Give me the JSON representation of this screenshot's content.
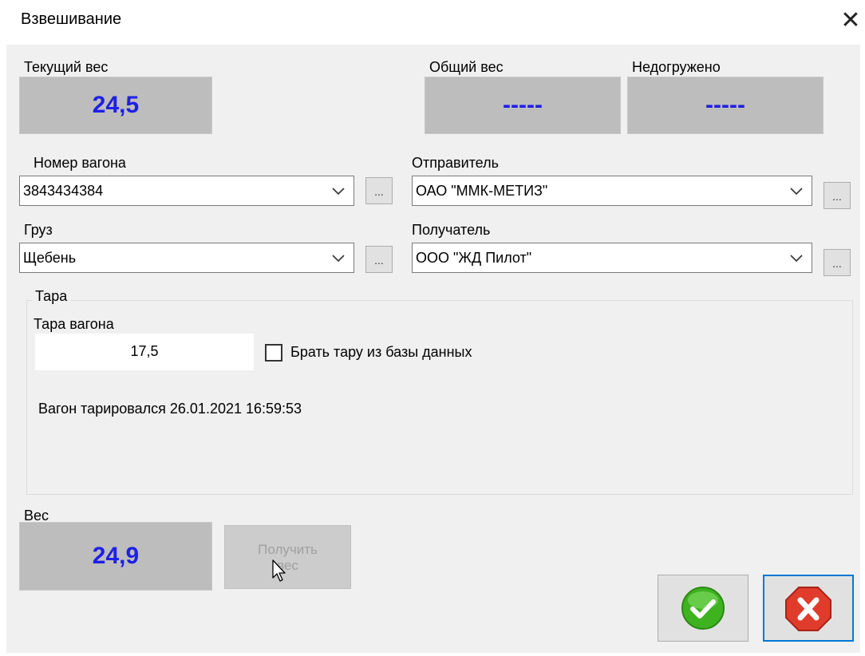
{
  "window": {
    "title": "Взвешивание"
  },
  "current_weight": {
    "label": "Текущий вес",
    "value": "24,5"
  },
  "total_weight": {
    "label": "Общий вес",
    "value": "-----"
  },
  "underloaded": {
    "label": "Недогружено",
    "value": "-----"
  },
  "wagon_number": {
    "label": "Номер вагона",
    "value": "3843434384",
    "browse_label": "..."
  },
  "sender": {
    "label": "Отправитель",
    "value": "ОАО \"ММК-МЕТИЗ\"",
    "browse_label": "..."
  },
  "cargo": {
    "label": "Груз",
    "value": "Щебень",
    "browse_label": "..."
  },
  "receiver": {
    "label": "Получатель",
    "value": "ООО \"ЖД Пилот\"",
    "browse_label": "..."
  },
  "tare": {
    "group_label": "Тара",
    "field_label": "Тара вагона",
    "value": "17,5",
    "checkbox_label": "Брать тару из базы данных",
    "checkbox_checked": false,
    "tared_text": "Вагон тарировался 26.01.2021 16:59:53"
  },
  "weight": {
    "label": "Вес",
    "value": "24,9"
  },
  "get_weight_button": {
    "line1": "Получить",
    "line2": "вес"
  },
  "colors": {
    "accent": "#0078d7",
    "weight_text": "#1f1fe6",
    "ok": "#3fb21f",
    "cancel": "#e03c2c"
  },
  "icons": {
    "ok": "check-circle-icon",
    "cancel": "cancel-octagon-icon",
    "close": "close-icon",
    "dropdown": "chevron-down-icon"
  }
}
